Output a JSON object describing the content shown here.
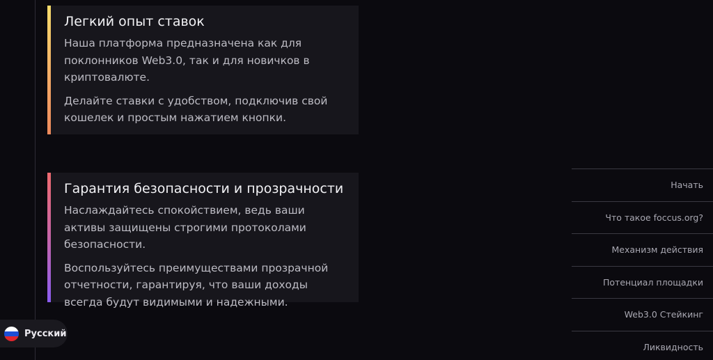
{
  "cards": [
    {
      "title": "Легкий опыт ставок",
      "paragraphs": [
        "Наша платформа предназначена как для поклонников Web3.0, так и для новичков в криптовалюте.",
        "Делайте ставки с удобством, подключив свой кошелек и простым нажатием кнопки."
      ]
    },
    {
      "title": "Гарантия безопасности и прозрачности",
      "paragraphs": [
        "Наслаждайтесь спокойствием, ведь ваши активы защищены строгими протоколами безопасности.",
        "Воспользуйтесь преимуществами прозрачной отчетности, гарантируя, что ваши доходы всегда будут видимыми и надежными."
      ]
    }
  ],
  "nav": {
    "items": [
      "Начать",
      "Что такое foccus.org?",
      "Механизм действия",
      "Потенциал площадки",
      "Web3.0 Стейкинг",
      "Ликвидность"
    ]
  },
  "language": {
    "label": "Русский",
    "flag_icon": "russia-flag-icon"
  }
}
